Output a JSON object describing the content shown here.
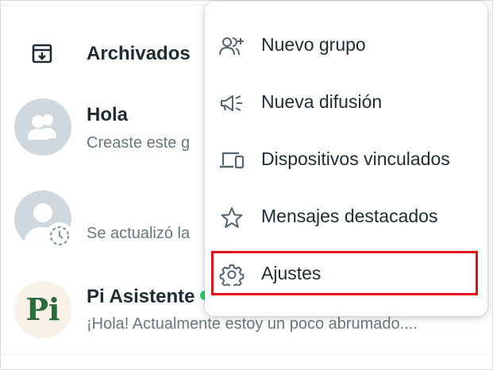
{
  "chat_list": {
    "archived": {
      "label": "Archivados",
      "icon": "archive-icon"
    },
    "chats": [
      {
        "title": "Hola",
        "subtitle": "Creaste este g",
        "avatar": "group-avatar-icon"
      },
      {
        "title": "",
        "subtitle": "Se actualizó la",
        "avatar": "person-avatar-icon",
        "badge": "status-pending-icon"
      },
      {
        "title": "Pi Asistente",
        "subtitle": "¡Hola! Actualmente estoy un poco abrumado....",
        "avatar_text": "Pi",
        "verified": true
      }
    ]
  },
  "menu": {
    "items": [
      {
        "label": "Nuevo grupo",
        "icon": "add-group-icon"
      },
      {
        "label": "Nueva difusión",
        "icon": "broadcast-icon"
      },
      {
        "label": "Dispositivos vinculados",
        "icon": "linked-devices-icon"
      },
      {
        "label": "Mensajes destacados",
        "icon": "star-icon"
      },
      {
        "label": "Ajustes",
        "icon": "gear-icon",
        "highlighted": true
      }
    ]
  },
  "colors": {
    "highlight": "#e0141e",
    "avatar_bg": "#cfd8df",
    "pi_green": "#2d6a3e",
    "icon_gray": "#54656f"
  }
}
